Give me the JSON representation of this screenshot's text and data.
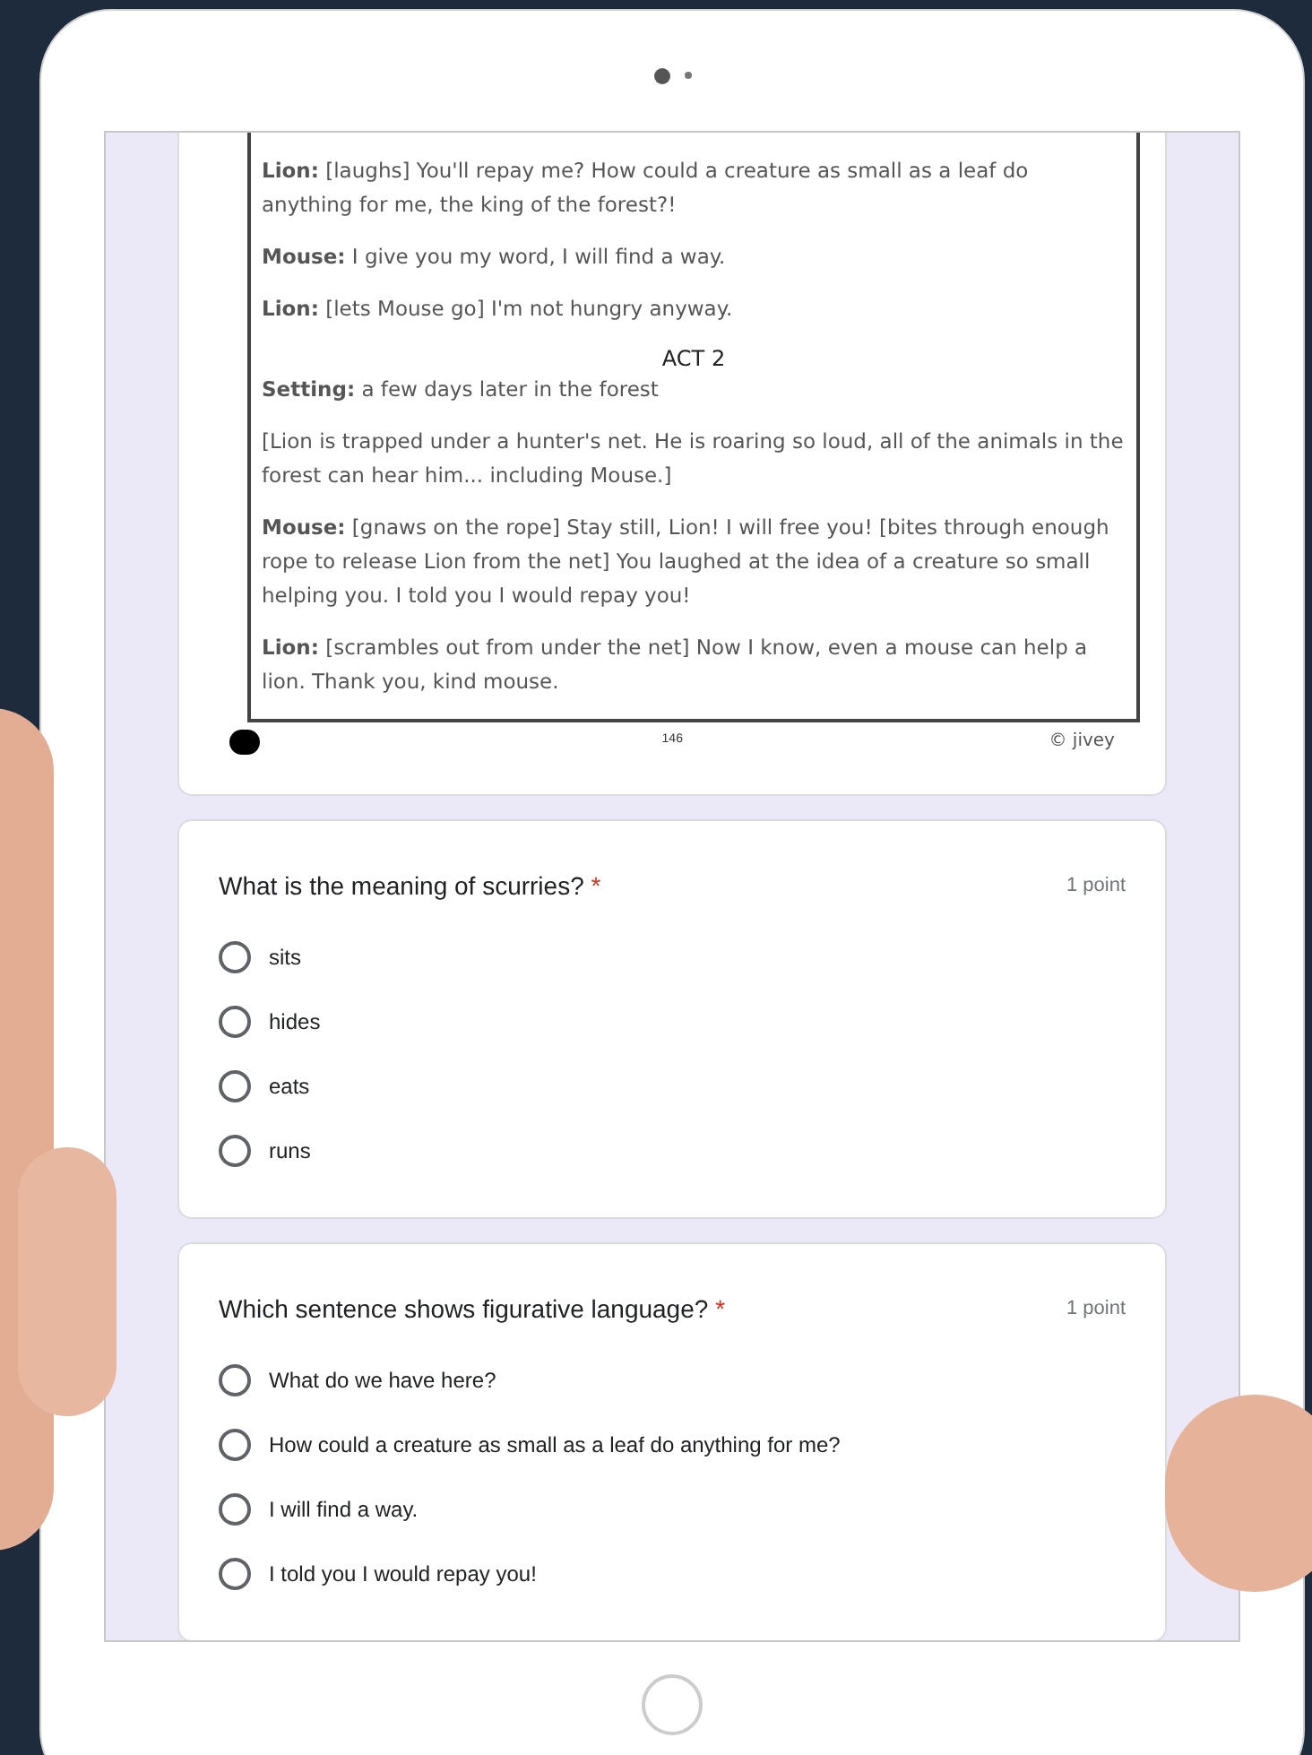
{
  "document": {
    "paragraphs": [
      {
        "kind": "line",
        "text": "**Lion:** [laughs] You'll repay me? How could a creature as small as a leaf do anything for me, the king of the forest?!"
      },
      {
        "kind": "line",
        "text": "**Mouse:** I give you my word, I will find a way."
      },
      {
        "kind": "line",
        "text": "**Lion:** [lets Mouse go] I'm not hungry anyway."
      },
      {
        "kind": "heading",
        "text": "ACT 2"
      },
      {
        "kind": "line",
        "text": "**Setting:** a few days later in the forest"
      },
      {
        "kind": "line",
        "text": "[Lion is trapped under a hunter's net. He is roaring so loud, all of the animals in the forest can hear him... including Mouse.]"
      },
      {
        "kind": "line",
        "text": "**Mouse:** [gnaws on the rope] Stay still, Lion! I will free you! [bites through enough rope to release Lion from the net] You laughed at the idea of a creature so small helping you. I told you I would repay you!"
      },
      {
        "kind": "line",
        "text": "**Lion:** [scrambles out from under the net] Now I know, even a mouse can help a lion. Thank you, kind mouse."
      }
    ],
    "page_number": "146",
    "credit": "© jivey"
  },
  "questions": [
    {
      "title": "What is the meaning of scurries?",
      "required_mark": "*",
      "points": "1 point",
      "options": [
        {
          "label": "sits",
          "selected": false
        },
        {
          "label": "hides",
          "selected": false
        },
        {
          "label": "eats",
          "selected": false
        },
        {
          "label": "runs",
          "selected": false
        }
      ]
    },
    {
      "title": "Which sentence shows figurative language?",
      "required_mark": "*",
      "points": "1 point",
      "options": [
        {
          "label": "What do we have here?",
          "selected": false
        },
        {
          "label": "How could a creature as small as a leaf do anything for me?",
          "selected": false
        },
        {
          "label": "I will find a way.",
          "selected": false
        },
        {
          "label": "I told you I would repay you!",
          "selected": false
        }
      ]
    }
  ]
}
